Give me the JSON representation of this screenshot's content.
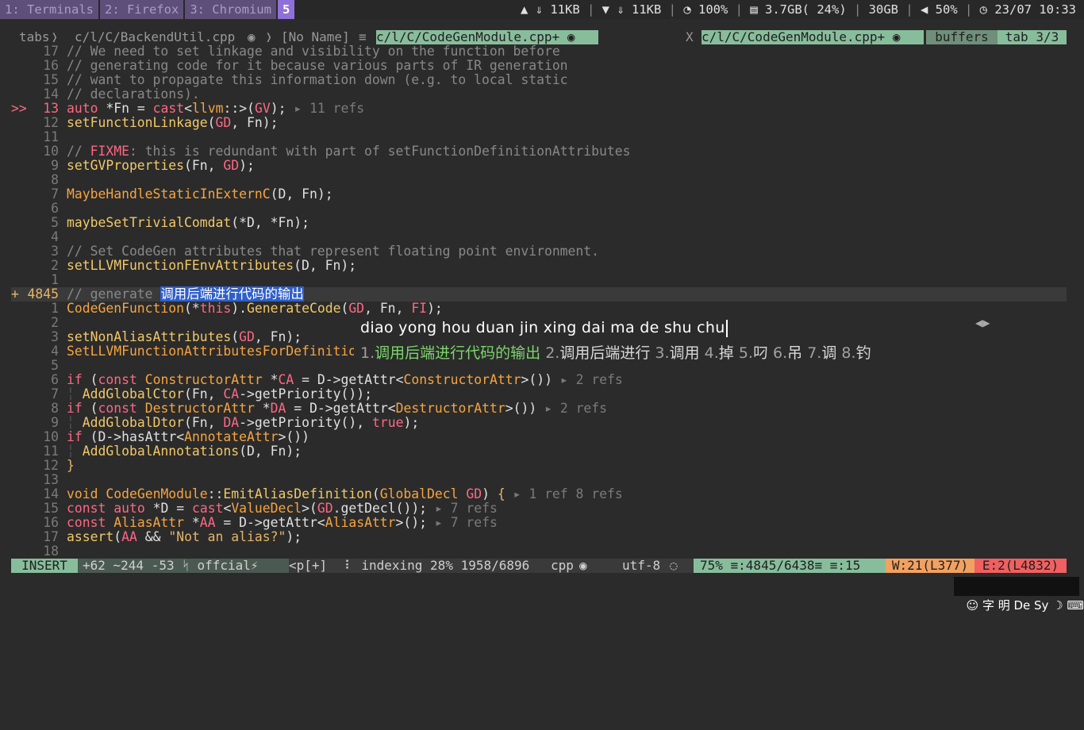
{
  "topbar": {
    "workspaces": [
      "1: Terminals",
      "2: Firefox",
      "3: Chromium",
      "5"
    ],
    "net1": "⇓ 11KB",
    "net2": "⇓ 11KB",
    "cpu": "100%",
    "mem": "3.7GB( 24%)",
    "disk": "30GB",
    "volume": "50%",
    "datetime": "23/07 10:33",
    "wifi_icon": "wifi-icon",
    "cpu_icon": "gauge-icon",
    "mem_icon": "memory-icon",
    "vol_icon": "speaker-icon",
    "clock_icon": "clock-icon"
  },
  "tabline": {
    "tabs_label": "tabs",
    "tab1": "c/l/C/BackendUtil.cpp",
    "tab2": "[No Name]",
    "tab3": "c/l/C/CodeGenModule.cpp+",
    "close": "X",
    "current": "c/l/C/CodeGenModule.cpp+",
    "buffers": "buffers",
    "tabcount": "tab 3/3"
  },
  "editor": {
    "sign_breakpoint": ">>",
    "sign_added": "+",
    "lines": {
      "l01_num": "17",
      "l01": "// We need to set linkage and visibility on the function before",
      "l02_num": "16",
      "l02": "// generating code for it because various parts of IR generation",
      "l03_num": "15",
      "l03": "// want to propagate this information down (e.g. to local static",
      "l04_num": "14",
      "l04": "// declarations).",
      "l05_num": "13",
      "l06_num": "12",
      "l07_num": "11",
      "l08_num": "10",
      "l08_fixme": "FIXME",
      "l09_num": "9",
      "l10_num": "8",
      "l11_num": "7",
      "l12_num": "6",
      "l13_num": "5",
      "l14_num": "4",
      "l14": "// Set CodeGen attributes that represent floating point environment.",
      "l15_num": "3",
      "l16_num": "2",
      "l17_num": "1",
      "l18_num": "4845",
      "l18_pre": "// generate ",
      "l18_sel": "调用后端进行代码的输出",
      "l19_num": "1",
      "l20_num": "2",
      "l21_num": "3",
      "l22_num": "4",
      "l23_num": "5",
      "l24_num": "6",
      "l25_num": "7",
      "l26_num": "8",
      "l27_num": "9",
      "l28_num": "10",
      "l29_num": "11",
      "l30_num": "12",
      "l31_num": "13",
      "l32_num": "14",
      "l33_num": "15",
      "l34_num": "16",
      "l35_num": "17",
      "l36_num": "18"
    },
    "refs": {
      "r13": "▸ 11 refs",
      "r6": "▸ 2 refs",
      "r8": "▸ 2 refs",
      "r14": "▸ 1 ref 8 refs",
      "r15": "▸ 7 refs",
      "r16": "▸ 7 refs"
    }
  },
  "ime": {
    "input": "diao yong hou duan jin xing dai ma de shu chu",
    "candidates": [
      {
        "num": "1.",
        "text": "调用后端进行代码的输出"
      },
      {
        "num": "2.",
        "text": "调用后端进行"
      },
      {
        "num": "3.",
        "text": "调用"
      },
      {
        "num": "4.",
        "text": "掉"
      },
      {
        "num": "5.",
        "text": "叼"
      },
      {
        "num": "6.",
        "text": "吊"
      },
      {
        "num": "7.",
        "text": "调"
      },
      {
        "num": "8.",
        "text": "钓"
      }
    ]
  },
  "statusline": {
    "mode": "INSERT",
    "git": "+62 ~244 -53 ᛋ offcial⚡",
    "path": "<p[+]",
    "indexing": "⠇ indexing 28% 1958/6896",
    "filetype": "cpp",
    "encoding": "utf-8",
    "position": "75% ≡:4845/6438≡ ≡:15",
    "warnings": "W:21(L377)",
    "errors": "E:2(L4832)"
  },
  "tray": {
    "text": "☺ 字 明 De Sy ☽ ⌨"
  },
  "colors": {
    "accent_green": "#88bd9c",
    "workspace_active": "#8f6fd8",
    "selection": "#2f5fc8",
    "keyword": "#fd6883",
    "function": "#f2c868",
    "warning": "#f2a160",
    "error": "#f06060"
  }
}
